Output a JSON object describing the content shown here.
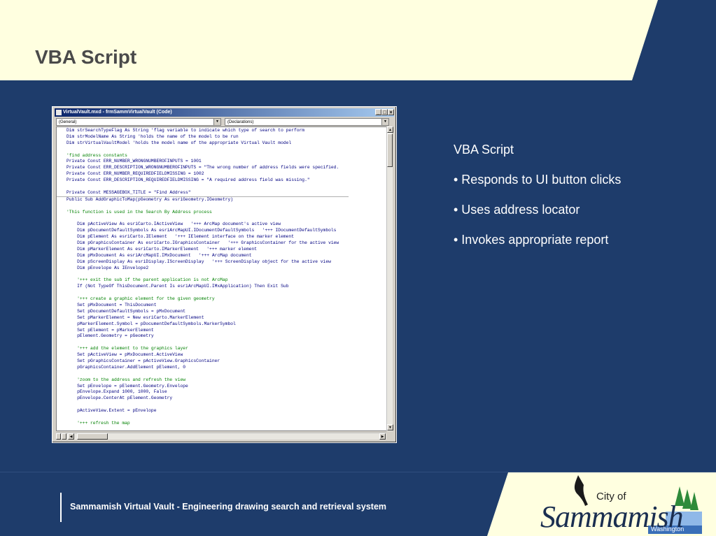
{
  "slide": {
    "title": "VBA Script",
    "bullets": [
      "VBA Script",
      "• Responds to UI button clicks",
      "• Uses address locator",
      "• Invokes appropriate report"
    ],
    "footer": "Sammamish Virtual Vault - Engineering drawing search and retrieval system",
    "colors": {
      "background": "#1e3c6b",
      "header": "#ffffe0",
      "title": "#4a4a4a"
    }
  },
  "logo": {
    "city": "City of",
    "name": "Sammamish",
    "state": "Washington"
  },
  "vba_window": {
    "title": "VirtualVault.mxd - frmSammVirtualVault (Code)",
    "object_combo": "(General)",
    "procedure_combo": "(Declarations)",
    "buttons": {
      "minimize": "_",
      "maximize": "□",
      "close": "×"
    },
    "declarations": [
      "Dim strSearchTypeFlag As String 'flag variable to indicate which type of search to perform",
      "Dim strModelName As String 'holds the name of the model to be run",
      "Dim strVirtualVaultModel 'holds the model name of the appropriate Virtual Vault model",
      "",
      "'find address constants",
      "Private Const ERR_NUMBER_WRONGNUMBEROFINPUTS = 1001",
      "Private Const ERR_DESCRIPTION_WRONGNUMBEROFINPUTS = \"The wrong number of address fields were specified.",
      "Private Const ERR_NUMBER_REQUIREDFIELDMISSING = 1002",
      "Private Const ERR_DESCRIPTION_REQUIREDFIELDMISSING = \"A required address field was missing.\"",
      "",
      "Private Const MESSAGEBOX_TITLE = \"Find Address\""
    ],
    "procedure": [
      "Public Sub AddGraphicToMap(pGeometry As esriGeometry.IGeometry)",
      "",
      "'This function is used in the Search By Address process",
      "",
      "    Dim pActiveView As esriCarto.IActiveView   '+++ ArcMap document's active view",
      "    Dim pDocumentDefaultSymbols As esriArcMapUI.IDocumentDefaultSymbols   '+++ IDocumentDefaultSymbols",
      "    Dim pElement As esriCarto.IElement   '+++ IElement interface on the marker element",
      "    Dim pGraphicsContainer As esriCarto.IGraphicsContainer   '+++ GraphicsContainer for the active view",
      "    Dim pMarkerElement As esriCarto.IMarkerElement   '+++ marker element",
      "    Dim pMxDocument As esriArcMapUI.IMxDocument   '+++ ArcMap document",
      "    Dim pScreenDisplay As esriDisplay.IScreenDisplay   '+++ ScreenDisplay object for the active view",
      "    Dim pEnvelope As IEnvelope2",
      "",
      "    '+++ exit the sub if the parent application is not ArcMap",
      "    If (Not TypeOf ThisDocument.Parent Is esriArcMapUI.IMxApplication) Then Exit Sub",
      "",
      "    '+++ create a graphic element for the given geometry",
      "    Set pMxDocument = ThisDocument",
      "    Set pDocumentDefaultSymbols = pMxDocument",
      "    Set pMarkerElement = New esriCarto.MarkerElement",
      "    pMarkerElement.Symbol = pDocumentDefaultSymbols.MarkerSymbol",
      "    Set pElement = pMarkerElement",
      "    pElement.Geometry = pGeometry",
      "",
      "    '+++ add the element to the graphics layer",
      "    Set pActiveView = pMxDocument.ActiveView",
      "    Set pGraphicsContainer = pActiveView.GraphicsContainer",
      "    pGraphicsContainer.AddElement pElement, 0",
      "",
      "    'zoom to the address and refresh the view",
      "    Set pEnvelope = pElement.Geometry.Envelope",
      "    pEnvelope.Expand 1000, 1000, False",
      "    pEnvelope.CenterAt pElement.Geometry",
      "",
      "    pActiveView.Extent = pEnvelope",
      "",
      "    '+++ refresh the map"
    ]
  }
}
